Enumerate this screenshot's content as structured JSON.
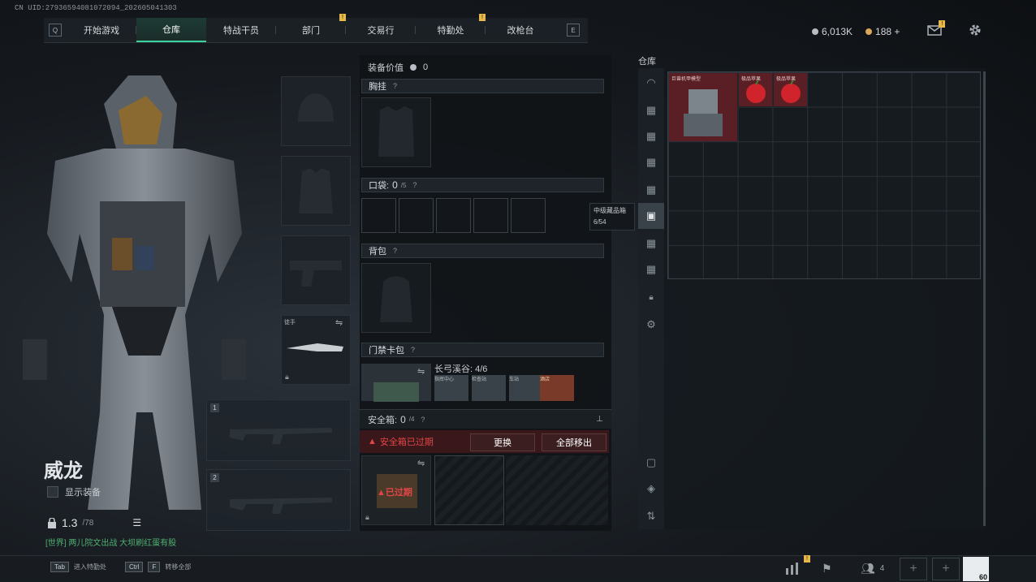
{
  "uid": "CN UID:27936594081072094_202605041303",
  "nav": {
    "left_key": "Q",
    "right_key": "E",
    "tabs": [
      {
        "label": "开始游戏"
      },
      {
        "label": "仓库"
      },
      {
        "label": "特战干员"
      },
      {
        "label": "部门",
        "badge": "!"
      },
      {
        "label": "交易行"
      },
      {
        "label": "特勤处",
        "badge": "!"
      },
      {
        "label": "改枪台"
      }
    ]
  },
  "currency": {
    "silver": "6,013K",
    "gold": "188",
    "plus": "+",
    "mail_badge": "!"
  },
  "character": {
    "name": "威龙",
    "show_gear_label": "显示装备",
    "weight": "1.3",
    "weight_max": "/78"
  },
  "world_chat": "[世界] 两儿院文出战 大坝刷红蛋有股",
  "equipment": {
    "melee_label": "徒手",
    "slot_1": "1",
    "slot_2": "2"
  },
  "loadout": {
    "value_label": "装备价值",
    "value": "0",
    "chest_rig": "胸挂",
    "pockets": "口袋:",
    "pockets_count": "0",
    "pockets_max": "/5",
    "backpack": "背包",
    "keycard": "门禁卡包",
    "keycard_map": "长弓溪谷: 4/6",
    "keycard_items": [
      "指挥中心",
      "检查站",
      "车站",
      "酒店"
    ],
    "safebox": "安全箱:",
    "safebox_count": "0",
    "safebox_max": "/4",
    "safebox_expired": "安全箱已过期",
    "replace_btn": "更换",
    "move_all_btn": "全部移出",
    "expired_tag": "已过期",
    "q": "?"
  },
  "tooltip": {
    "title": "中级藏品箱",
    "count": "6/54"
  },
  "warehouse": {
    "title": "仓库",
    "items": [
      {
        "label": "巨兽机甲模型"
      },
      {
        "label": "极品苹果"
      },
      {
        "label": "极品苹果"
      }
    ]
  },
  "bottom": {
    "tab_key": "Tab",
    "tab_hint": "进入特勤处",
    "ctrl_key": "Ctrl",
    "f_key": "F",
    "ctrl_hint": "转移全部",
    "squad_count": "4",
    "level": "60",
    "stats_badge": "!"
  },
  "colors": {
    "accent": "#39d39b",
    "warning": "#e6b84a",
    "danger": "#e04646"
  }
}
